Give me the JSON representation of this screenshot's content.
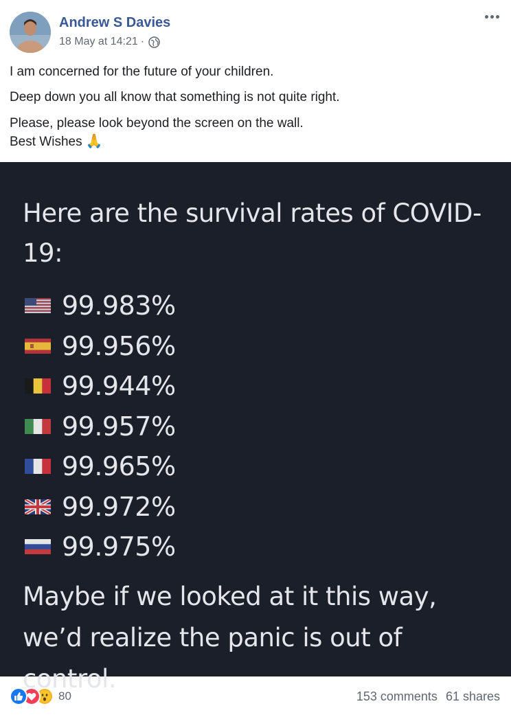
{
  "post": {
    "author": "Andrew S Davies",
    "timestamp": "18 May at 14:21",
    "separator": "·",
    "privacy_icon": "globe-icon",
    "more_icon": "more-options-icon",
    "text_lines": [
      "I am concerned for the future of your children.",
      "Deep down you all know that something is not quite right.",
      "Please, please look beyond the screen on the wall.",
      "Best Wishes"
    ],
    "emoji": "🙏"
  },
  "image": {
    "title": "Here are the survival rates of COVID-19:",
    "rates": [
      {
        "flag": "usa-flag-icon",
        "value": "99.983%"
      },
      {
        "flag": "spain-flag-icon",
        "value": "99.956%"
      },
      {
        "flag": "belgium-flag-icon",
        "value": "99.944%"
      },
      {
        "flag": "italy-flag-icon",
        "value": "99.957%"
      },
      {
        "flag": "france-flag-icon",
        "value": "99.965%"
      },
      {
        "flag": "uk-flag-icon",
        "value": "99.972%"
      },
      {
        "flag": "russia-flag-icon",
        "value": "99.975%"
      }
    ],
    "footer": "Maybe if we looked at it this way, we’d realize the panic is out of control."
  },
  "footer": {
    "reactions": [
      "like-icon",
      "love-icon",
      "wow-icon"
    ],
    "reaction_count": "80",
    "comments": "153 comments",
    "shares": "61 shares"
  },
  "colors": {
    "author": "#385898",
    "meta": "#606770",
    "image_bg": "#1b1f2a",
    "image_text": "#e4e6ea",
    "like": "#1877f2",
    "love": "#f33e58",
    "wow": "#f7b125"
  }
}
